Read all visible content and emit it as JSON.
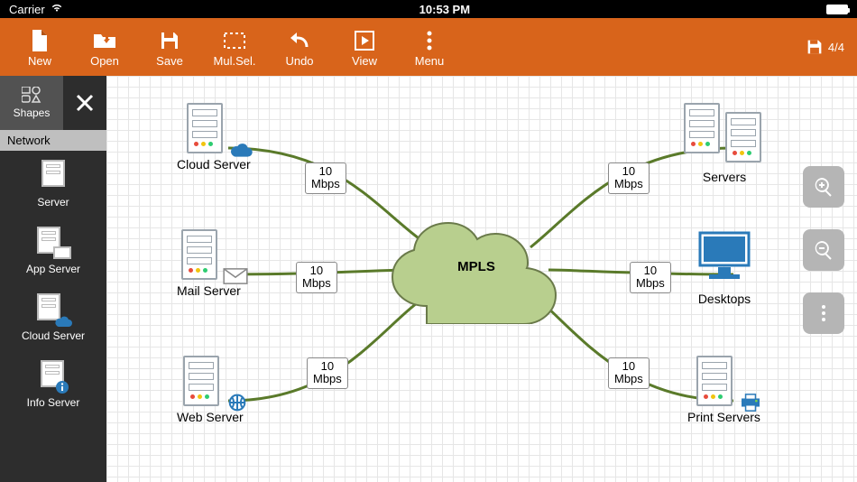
{
  "statusbar": {
    "carrier": "Carrier",
    "time": "10:53 PM"
  },
  "toolbar": {
    "new": "New",
    "open": "Open",
    "save": "Save",
    "mulsel": "Mul.Sel.",
    "undo": "Undo",
    "view": "View",
    "menu": "Menu",
    "page": "4/4"
  },
  "sidebar": {
    "shapes": "Shapes",
    "category": "Network",
    "items": [
      {
        "label": "Server"
      },
      {
        "label": "App Server"
      },
      {
        "label": "Cloud Server"
      },
      {
        "label": "Info Server"
      }
    ]
  },
  "diagram": {
    "center": "MPLS",
    "nodes": [
      {
        "label": "Cloud Server"
      },
      {
        "label": "Mail Server"
      },
      {
        "label": "Web Server"
      },
      {
        "label": "Servers"
      },
      {
        "label": "Desktops"
      },
      {
        "label": "Print Servers"
      }
    ],
    "link_label_line1": "10",
    "link_label_line2": "Mbps"
  }
}
